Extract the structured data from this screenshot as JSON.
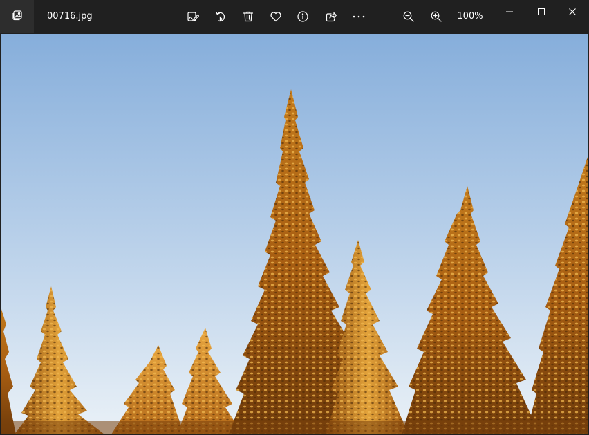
{
  "titlebar": {
    "file_name": "00716.jpg",
    "zoom_level": "100%"
  },
  "icons": {
    "app": "photos-app-icon",
    "edit": "edit-image-icon",
    "rotate": "rotate-icon",
    "delete": "trash-icon",
    "favorite": "heart-icon",
    "info": "info-icon",
    "share": "share-icon",
    "more": "more-options-icon",
    "zoom_out": "zoom-out-icon",
    "zoom_in": "zoom-in-icon",
    "minimize": "minimize-icon",
    "maximize": "maximize-icon",
    "close": "close-icon"
  },
  "colors": {
    "titlebar_bg": "#202020",
    "app_icon_bg": "#2d2d2d",
    "icon_color": "#ffffff",
    "sky_top": "#86aedb",
    "sky_bottom": "#eaf1f7",
    "tree_gold": "#d7902a",
    "tree_dark": "#5a3208"
  }
}
